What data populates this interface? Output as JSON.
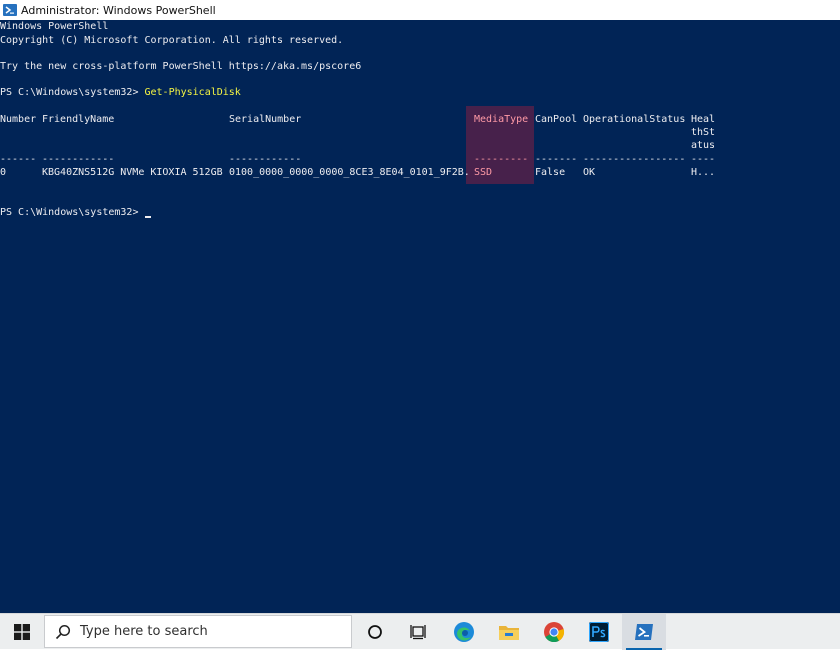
{
  "window": {
    "title": "Administrator: Windows PowerShell"
  },
  "console": {
    "banner_line1": "Windows PowerShell",
    "banner_line2": "Copyright (C) Microsoft Corporation. All rights reserved.",
    "banner_line3": "Try the new cross-platform PowerShell https://aka.ms/pscore6",
    "prompt1": "PS C:\\Windows\\system32> ",
    "command1": "Get-PhysicalDisk",
    "table": {
      "headers": {
        "number": "Number",
        "friendly_name": "FriendlyName",
        "serial_number": "SerialNumber",
        "media_type": "MediaType",
        "can_pool": "CanPool",
        "operational_status": "OperationalStatus",
        "health_status_line1": "Heal",
        "health_status_line2": "thSt",
        "health_status_line3": "atus"
      },
      "separators": {
        "number": "------",
        "friendly_name": "------------",
        "serial_number": "------------",
        "media_type": "---------",
        "can_pool": "-------",
        "operational_status": "-----------------",
        "health_status": "----"
      },
      "rows": [
        {
          "number": "0",
          "friendly_name": "KBG40ZNS512G NVMe KIOXIA 512GB",
          "serial_number": "0100_0000_0000_0000_8CE3_8E04_0101_9F2B.",
          "media_type": "SSD",
          "can_pool": "False",
          "operational_status": "OK",
          "health_status": "H..."
        }
      ]
    },
    "prompt2": "PS C:\\Windows\\system32> "
  },
  "taskbar": {
    "search_placeholder": "Type here to search",
    "icons": [
      "windows-start-icon",
      "search-icon",
      "cortana-icon",
      "task-view-icon",
      "edge-icon",
      "file-explorer-icon",
      "chrome-icon",
      "photoshop-icon",
      "powershell-icon"
    ]
  },
  "colors": {
    "console_bg": "#012456",
    "console_text": "#eeedf0",
    "command_text": "#f5f543",
    "highlight": "#aa1e3c"
  }
}
